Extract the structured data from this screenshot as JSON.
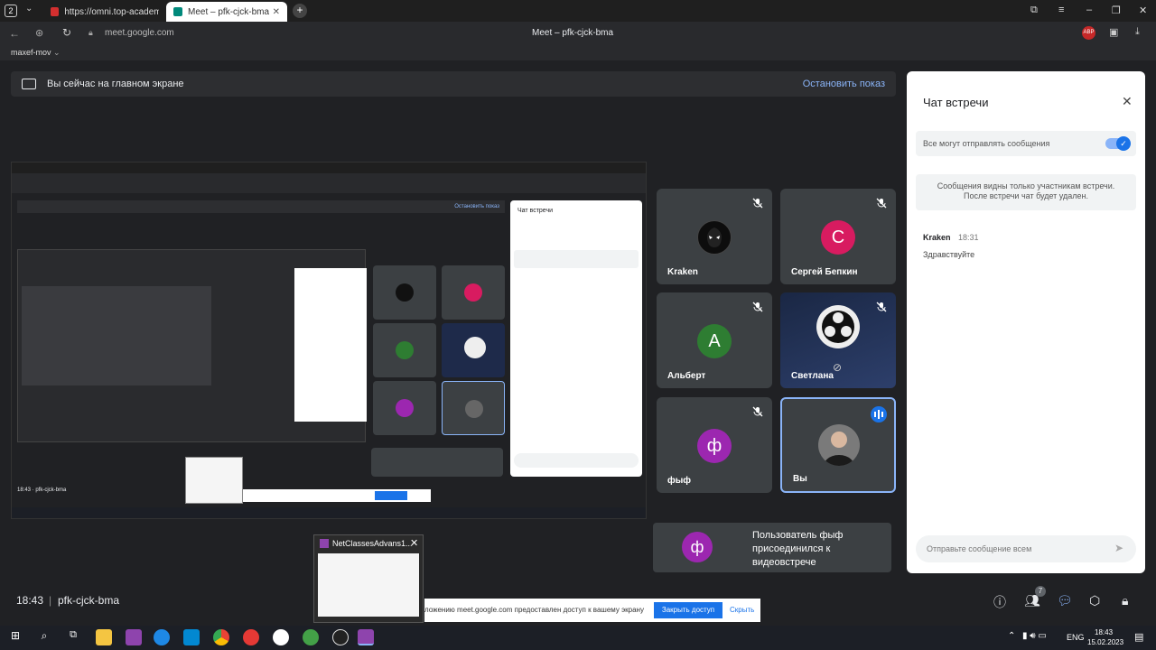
{
  "browser": {
    "tab_count": "2",
    "tabs": [
      {
        "title": "https://omni.top-academy"
      },
      {
        "title": "Meet – pfk-cjck-bma"
      }
    ],
    "url": "meet.google.com",
    "page_title": "Meet – pfk-cjck-bma",
    "bookmark": "maxef-mov"
  },
  "banner": {
    "text": "Вы сейчас на главном экране",
    "stop_label": "Остановить показ"
  },
  "participants": [
    {
      "name": "Kraken",
      "initial": "",
      "color": "#1a1a1a"
    },
    {
      "name": "Сергей Бепкин",
      "initial": "С",
      "color": "#d81b60"
    },
    {
      "name": "Альберт",
      "initial": "А",
      "color": "#2e7d32"
    },
    {
      "name": "Светлана",
      "initial": "",
      "color": "#1e2a4a"
    },
    {
      "name": "фыф",
      "initial": "ф",
      "color": "#9c27b0"
    },
    {
      "name": "Вы",
      "initial": "",
      "color": "#555"
    }
  ],
  "chat": {
    "title": "Чат встречи",
    "toggle_label": "Все могут отправлять сообщения",
    "notice": "Сообщения видны только участникам встречи. После встречи чат будет удален.",
    "message_author": "Kraken",
    "message_time": "18:31",
    "message_text": "Здравствуйте",
    "input_placeholder": "Отправьте сообщение всем"
  },
  "toast": {
    "initial": "ф",
    "text": "Пользователь фыф присоединился к видеовстрече"
  },
  "meeting": {
    "time": "18:43",
    "code": "pfk-cjck-bma",
    "participant_count": "7"
  },
  "share_bar": {
    "text": "ложению meet.google.com предоставлен доступ к вашему экрану",
    "close_access": "Закрыть доступ",
    "hide": "Скрыть"
  },
  "taskbar": {
    "preview_title": "NetClassesAdvans1...",
    "lang": "ENG",
    "clock_time": "18:43",
    "clock_date": "15.02.2023"
  },
  "inner": {
    "stop_label": "Остановить показ",
    "chat_title": "Чат встречи",
    "footer": "18:43 · pfk-cjck-bma"
  },
  "colors": {
    "bg": "#202124",
    "tile": "#3c4043",
    "accent": "#1a73e8",
    "stop": "#ea4335"
  }
}
